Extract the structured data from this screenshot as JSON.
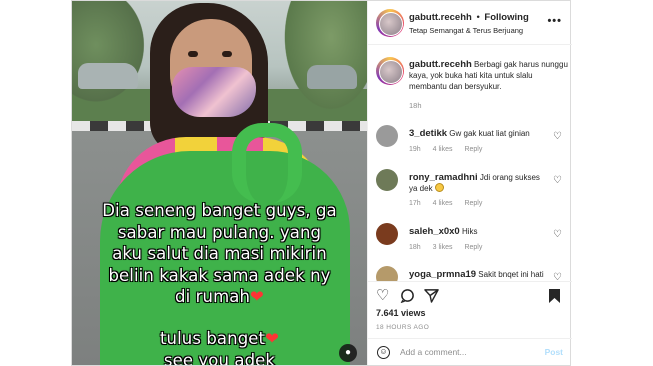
{
  "media": {
    "caption_lines": [
      "Dia seneng banget guys, ga",
      "sabar mau pulang. yang",
      "aku salut dia masi mikirin",
      "beliin kakak sama adek ny",
      "di rumah"
    ],
    "caption_lines_2": [
      "tulus banget",
      "see you adek"
    ],
    "heart": "❤"
  },
  "header": {
    "username": "gabutt.recehh",
    "separator": "•",
    "follow_label": "Following",
    "location": "Tetap Semangat & Terus Berjuang",
    "more": "•••"
  },
  "caption": {
    "username": "gabutt.recehh",
    "text": "Berbagi gak harus nunggu kaya, yok buka hati kita untuk slalu membantu dan bersyukur.",
    "time": "18h"
  },
  "comments": [
    {
      "username": "3_detikk",
      "text": "Gw gak kuat liat ginian",
      "time": "19h",
      "likes": "4 likes",
      "reply": "Reply",
      "avatar_color": "#9a9a9a"
    },
    {
      "username": "rony_ramadhni",
      "text": "Jdi orang sukses ya dek",
      "time": "17h",
      "likes": "4 likes",
      "reply": "Reply",
      "avatar_color": "#6e7a58"
    },
    {
      "username": "saleh_x0x0",
      "text": "Hiks",
      "time": "18h",
      "likes": "3 likes",
      "reply": "Reply",
      "avatar_color": "#7a3b1e"
    },
    {
      "username": "yoga_prmna19",
      "text": "Sakit bnqet ini hati",
      "time": "",
      "likes": "",
      "reply": "",
      "avatar_color": "#b59a6a"
    }
  ],
  "stats": {
    "views": "7.641 views",
    "time_ago": "18 HOURS AGO"
  },
  "add_comment": {
    "placeholder": "Add a comment...",
    "post_label": "Post"
  }
}
